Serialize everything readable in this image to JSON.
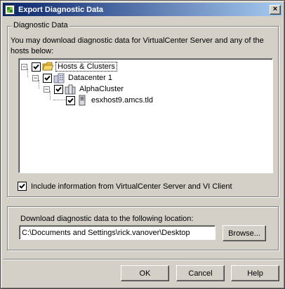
{
  "window": {
    "title": "Export Diagnostic Data",
    "close_glyph": "×"
  },
  "diagnostic_group": {
    "label": "Diagnostic Data",
    "description": "You may download diagnostic data for VirtualCenter Server and any of the hosts below:"
  },
  "tree": {
    "items": [
      {
        "label": "Hosts & Clusters",
        "checked": true,
        "expanded": true,
        "icon": "folder-icon"
      },
      {
        "label": "Datacenter 1",
        "checked": true,
        "expanded": true,
        "icon": "datacenter-icon"
      },
      {
        "label": "AlphaCluster",
        "checked": true,
        "expanded": true,
        "icon": "cluster-icon"
      },
      {
        "label": "esxhost9.amcs.tld",
        "checked": true,
        "icon": "host-icon"
      }
    ],
    "expander_glyph": "−"
  },
  "include_option": {
    "label": "Include information from VirtualCenter Server and VI Client",
    "checked": true
  },
  "location_group": {
    "label": "Download diagnostic data to the following location:",
    "path_value": "C:\\Documents and Settings\\rick.vanover\\Desktop",
    "browse_label": "Browse..."
  },
  "buttons": {
    "ok_label": "OK",
    "cancel_label": "Cancel",
    "help_label": "Help"
  },
  "colors": {
    "title_start": "#0a246a",
    "title_end": "#a6caf0",
    "face": "#d4d0c8"
  }
}
